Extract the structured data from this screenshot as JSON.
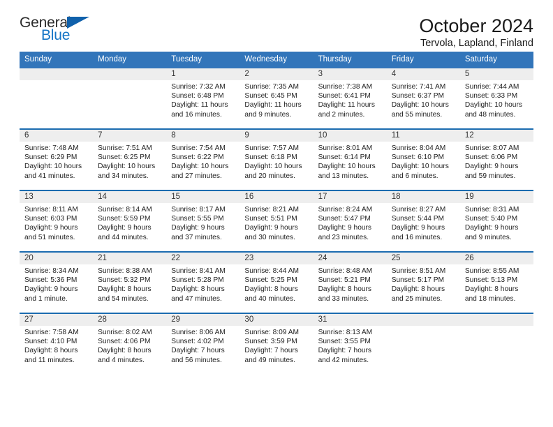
{
  "brand": {
    "name_top": "General",
    "name_bottom": "Blue",
    "flag_icon": "triangle-flag-icon",
    "color_dark": "#2b2b2b",
    "color_blue": "#1675c6"
  },
  "header": {
    "title": "October 2024",
    "subtitle": "Tervola, Lapland, Finland"
  },
  "theme": {
    "header_row_bg": "#3275ba",
    "week_divider": "#1b6cb0",
    "date_band_bg": "#eeeeee"
  },
  "calendar": {
    "weekday_headers": [
      "Sunday",
      "Monday",
      "Tuesday",
      "Wednesday",
      "Thursday",
      "Friday",
      "Saturday"
    ],
    "labels": {
      "sunrise": "Sunrise:",
      "sunset": "Sunset:",
      "daylight": "Daylight:"
    },
    "weeks": [
      [
        {
          "day": "",
          "empty": true
        },
        {
          "day": "",
          "empty": true
        },
        {
          "day": "1",
          "sunrise": "Sunrise: 7:32 AM",
          "sunset": "Sunset: 6:48 PM",
          "daylight_1": "Daylight: 11 hours",
          "daylight_2": "and 16 minutes."
        },
        {
          "day": "2",
          "sunrise": "Sunrise: 7:35 AM",
          "sunset": "Sunset: 6:45 PM",
          "daylight_1": "Daylight: 11 hours",
          "daylight_2": "and 9 minutes."
        },
        {
          "day": "3",
          "sunrise": "Sunrise: 7:38 AM",
          "sunset": "Sunset: 6:41 PM",
          "daylight_1": "Daylight: 11 hours",
          "daylight_2": "and 2 minutes."
        },
        {
          "day": "4",
          "sunrise": "Sunrise: 7:41 AM",
          "sunset": "Sunset: 6:37 PM",
          "daylight_1": "Daylight: 10 hours",
          "daylight_2": "and 55 minutes."
        },
        {
          "day": "5",
          "sunrise": "Sunrise: 7:44 AM",
          "sunset": "Sunset: 6:33 PM",
          "daylight_1": "Daylight: 10 hours",
          "daylight_2": "and 48 minutes."
        }
      ],
      [
        {
          "day": "6",
          "sunrise": "Sunrise: 7:48 AM",
          "sunset": "Sunset: 6:29 PM",
          "daylight_1": "Daylight: 10 hours",
          "daylight_2": "and 41 minutes."
        },
        {
          "day": "7",
          "sunrise": "Sunrise: 7:51 AM",
          "sunset": "Sunset: 6:25 PM",
          "daylight_1": "Daylight: 10 hours",
          "daylight_2": "and 34 minutes."
        },
        {
          "day": "8",
          "sunrise": "Sunrise: 7:54 AM",
          "sunset": "Sunset: 6:22 PM",
          "daylight_1": "Daylight: 10 hours",
          "daylight_2": "and 27 minutes."
        },
        {
          "day": "9",
          "sunrise": "Sunrise: 7:57 AM",
          "sunset": "Sunset: 6:18 PM",
          "daylight_1": "Daylight: 10 hours",
          "daylight_2": "and 20 minutes."
        },
        {
          "day": "10",
          "sunrise": "Sunrise: 8:01 AM",
          "sunset": "Sunset: 6:14 PM",
          "daylight_1": "Daylight: 10 hours",
          "daylight_2": "and 13 minutes."
        },
        {
          "day": "11",
          "sunrise": "Sunrise: 8:04 AM",
          "sunset": "Sunset: 6:10 PM",
          "daylight_1": "Daylight: 10 hours",
          "daylight_2": "and 6 minutes."
        },
        {
          "day": "12",
          "sunrise": "Sunrise: 8:07 AM",
          "sunset": "Sunset: 6:06 PM",
          "daylight_1": "Daylight: 9 hours",
          "daylight_2": "and 59 minutes."
        }
      ],
      [
        {
          "day": "13",
          "sunrise": "Sunrise: 8:11 AM",
          "sunset": "Sunset: 6:03 PM",
          "daylight_1": "Daylight: 9 hours",
          "daylight_2": "and 51 minutes."
        },
        {
          "day": "14",
          "sunrise": "Sunrise: 8:14 AM",
          "sunset": "Sunset: 5:59 PM",
          "daylight_1": "Daylight: 9 hours",
          "daylight_2": "and 44 minutes."
        },
        {
          "day": "15",
          "sunrise": "Sunrise: 8:17 AM",
          "sunset": "Sunset: 5:55 PM",
          "daylight_1": "Daylight: 9 hours",
          "daylight_2": "and 37 minutes."
        },
        {
          "day": "16",
          "sunrise": "Sunrise: 8:21 AM",
          "sunset": "Sunset: 5:51 PM",
          "daylight_1": "Daylight: 9 hours",
          "daylight_2": "and 30 minutes."
        },
        {
          "day": "17",
          "sunrise": "Sunrise: 8:24 AM",
          "sunset": "Sunset: 5:47 PM",
          "daylight_1": "Daylight: 9 hours",
          "daylight_2": "and 23 minutes."
        },
        {
          "day": "18",
          "sunrise": "Sunrise: 8:27 AM",
          "sunset": "Sunset: 5:44 PM",
          "daylight_1": "Daylight: 9 hours",
          "daylight_2": "and 16 minutes."
        },
        {
          "day": "19",
          "sunrise": "Sunrise: 8:31 AM",
          "sunset": "Sunset: 5:40 PM",
          "daylight_1": "Daylight: 9 hours",
          "daylight_2": "and 9 minutes."
        }
      ],
      [
        {
          "day": "20",
          "sunrise": "Sunrise: 8:34 AM",
          "sunset": "Sunset: 5:36 PM",
          "daylight_1": "Daylight: 9 hours",
          "daylight_2": "and 1 minute."
        },
        {
          "day": "21",
          "sunrise": "Sunrise: 8:38 AM",
          "sunset": "Sunset: 5:32 PM",
          "daylight_1": "Daylight: 8 hours",
          "daylight_2": "and 54 minutes."
        },
        {
          "day": "22",
          "sunrise": "Sunrise: 8:41 AM",
          "sunset": "Sunset: 5:28 PM",
          "daylight_1": "Daylight: 8 hours",
          "daylight_2": "and 47 minutes."
        },
        {
          "day": "23",
          "sunrise": "Sunrise: 8:44 AM",
          "sunset": "Sunset: 5:25 PM",
          "daylight_1": "Daylight: 8 hours",
          "daylight_2": "and 40 minutes."
        },
        {
          "day": "24",
          "sunrise": "Sunrise: 8:48 AM",
          "sunset": "Sunset: 5:21 PM",
          "daylight_1": "Daylight: 8 hours",
          "daylight_2": "and 33 minutes."
        },
        {
          "day": "25",
          "sunrise": "Sunrise: 8:51 AM",
          "sunset": "Sunset: 5:17 PM",
          "daylight_1": "Daylight: 8 hours",
          "daylight_2": "and 25 minutes."
        },
        {
          "day": "26",
          "sunrise": "Sunrise: 8:55 AM",
          "sunset": "Sunset: 5:13 PM",
          "daylight_1": "Daylight: 8 hours",
          "daylight_2": "and 18 minutes."
        }
      ],
      [
        {
          "day": "27",
          "sunrise": "Sunrise: 7:58 AM",
          "sunset": "Sunset: 4:10 PM",
          "daylight_1": "Daylight: 8 hours",
          "daylight_2": "and 11 minutes."
        },
        {
          "day": "28",
          "sunrise": "Sunrise: 8:02 AM",
          "sunset": "Sunset: 4:06 PM",
          "daylight_1": "Daylight: 8 hours",
          "daylight_2": "and 4 minutes."
        },
        {
          "day": "29",
          "sunrise": "Sunrise: 8:06 AM",
          "sunset": "Sunset: 4:02 PM",
          "daylight_1": "Daylight: 7 hours",
          "daylight_2": "and 56 minutes."
        },
        {
          "day": "30",
          "sunrise": "Sunrise: 8:09 AM",
          "sunset": "Sunset: 3:59 PM",
          "daylight_1": "Daylight: 7 hours",
          "daylight_2": "and 49 minutes."
        },
        {
          "day": "31",
          "sunrise": "Sunrise: 8:13 AM",
          "sunset": "Sunset: 3:55 PM",
          "daylight_1": "Daylight: 7 hours",
          "daylight_2": "and 42 minutes."
        },
        {
          "day": "",
          "empty": true
        },
        {
          "day": "",
          "empty": true
        }
      ]
    ]
  }
}
